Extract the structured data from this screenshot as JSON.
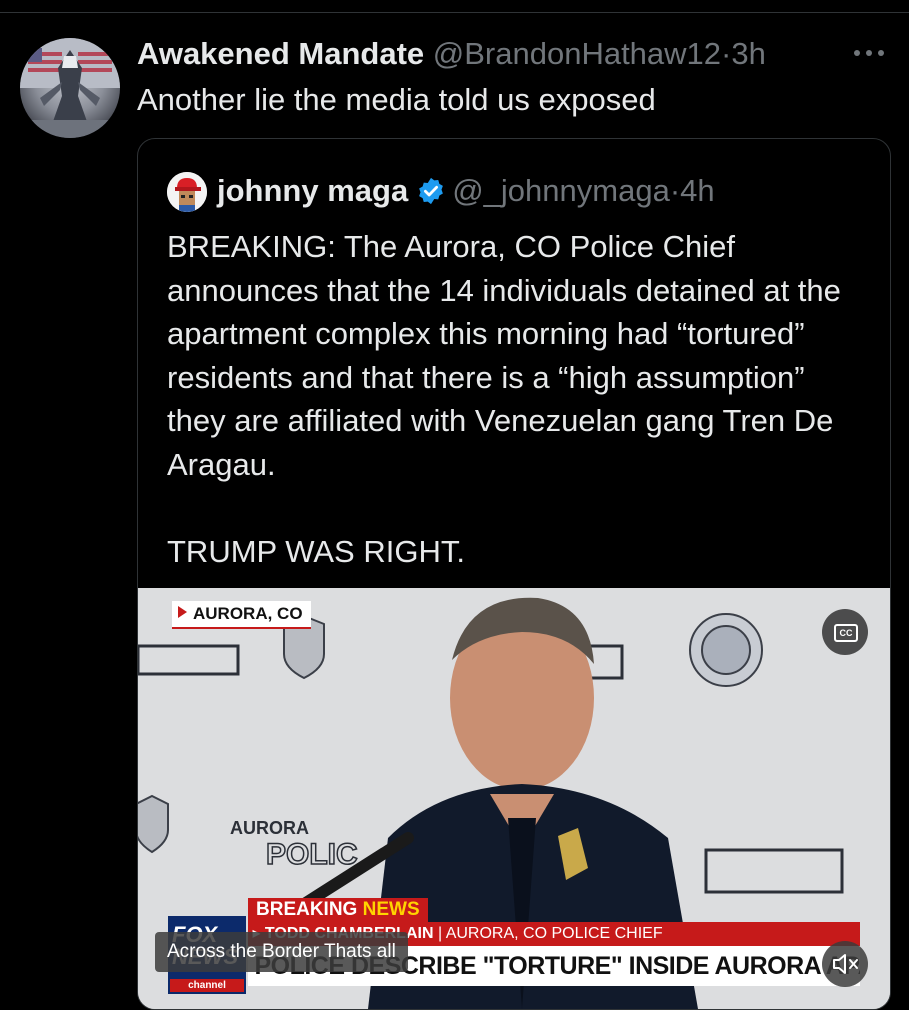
{
  "post": {
    "author_name": "Awakened Mandate",
    "handle": "@BrandonHathaw12",
    "separator": "·",
    "time": "3h",
    "text": "Another lie the media told us exposed"
  },
  "quoted": {
    "author_name": "johnny maga",
    "handle": "@_johnnymaga",
    "separator": "·",
    "time": "4h",
    "text": "BREAKING: The Aurora, CO Police Chief announces that the 14 individuals detained at the apartment complex this morning had “tortured” residents and that there is a “high assumption” they are affiliated with Venezuelan gang Tren De Aragau.\n\nTRUMP WAS RIGHT."
  },
  "video": {
    "location_tag": "AURORA, CO",
    "breaking": "BREAKING",
    "news": "NEWS",
    "speaker_name": "TODD CHAMBERLAIN",
    "speaker_title": "AURORA, CO POLICE CHIEF",
    "headline": "POLICE DESCRIBE \"TORTURE\" INSIDE AURORA APARTMENT",
    "network_logo_text": "FOX NEWS",
    "network_channel": "channel",
    "caption": "Across the Border Thats all",
    "cc_label": "CC"
  },
  "colors": {
    "background": "#000000",
    "text": "#e7e9ea",
    "muted": "#71767b",
    "border": "#2f3336",
    "verified": "#1d9bf0",
    "news_red": "#c61a1a"
  },
  "icons": [
    "more-icon",
    "verified-icon",
    "cc-icon",
    "mute-icon"
  ]
}
